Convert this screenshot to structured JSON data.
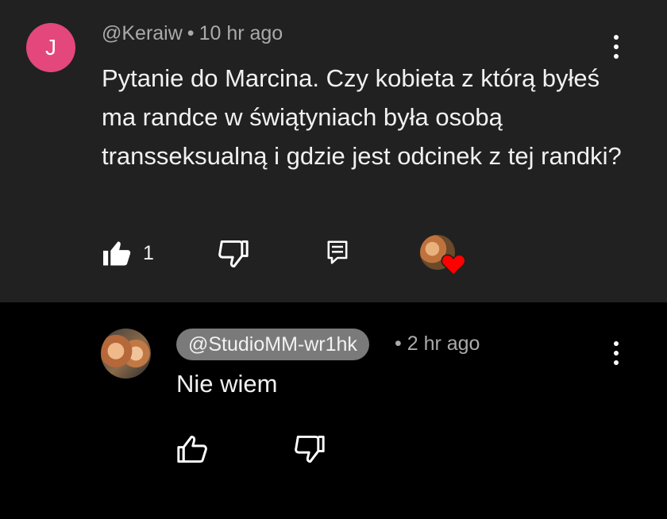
{
  "comment": {
    "avatar_letter": "J",
    "author": "@Keraiw",
    "separator": "•",
    "time": "10 hr ago",
    "text": "Pytanie do Marcina. Czy kobieta z którą byłeś ma randce w świątyniach była osobą transseksualną i gdzie jest odcinek z tej randki?",
    "like_count": "1",
    "colors": {
      "avatar_bg": "#e3477c",
      "panel_bg": "#212121",
      "heart": "#ff0000"
    },
    "icons": [
      "thumb-up-filled-icon",
      "thumb-down-icon",
      "reply-icon",
      "creator-heart-icon",
      "more-vert-icon"
    ]
  },
  "reply": {
    "author": "@StudioMM-wr1hk",
    "separator": "•",
    "time": "2 hr ago",
    "text": "Nie wiem",
    "colors": {
      "handle_pill_bg": "#7a7a7a"
    },
    "icons": [
      "thumb-up-icon",
      "thumb-down-icon",
      "more-vert-icon"
    ]
  }
}
